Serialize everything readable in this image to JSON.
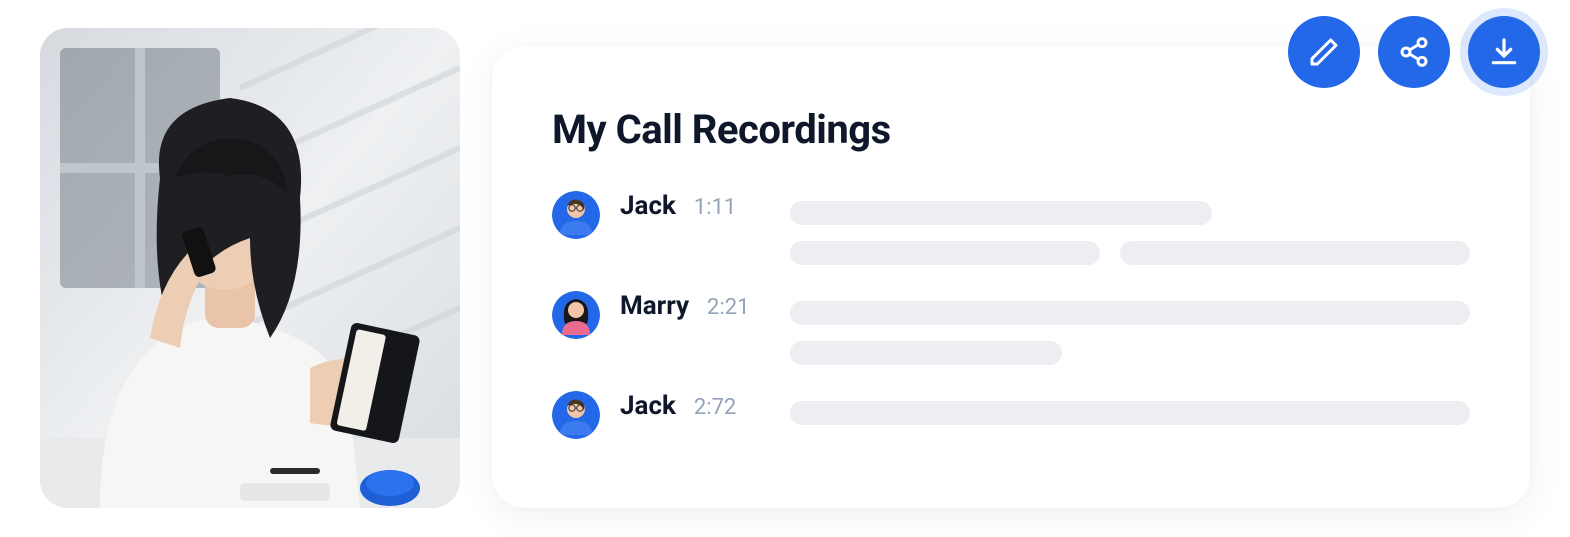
{
  "card": {
    "title": "My Call Recordings",
    "entries": [
      {
        "name": "Jack",
        "time": "1:11",
        "avatar": "male"
      },
      {
        "name": "Marry",
        "time": "2:21",
        "avatar": "female"
      },
      {
        "name": "Jack",
        "time": "2:72",
        "avatar": "male"
      }
    ]
  },
  "actions": {
    "edit_icon": "pencil-icon",
    "share_icon": "share-icon",
    "download_icon": "download-icon"
  },
  "colors": {
    "accent": "#2368e8",
    "text": "#0f172a",
    "muted": "#94a3b8",
    "skeleton": "#eceef1"
  }
}
